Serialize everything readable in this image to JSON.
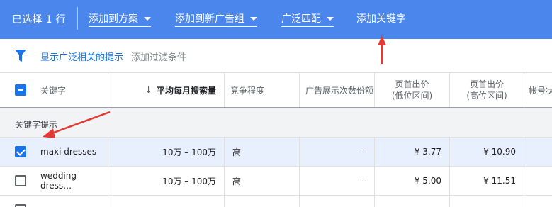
{
  "toolbar": {
    "selection": "已选择 1 行",
    "add_to_plan": "添加到方案",
    "add_to_new_ad_group": "添加到新广告组",
    "match_type": "广泛匹配",
    "add_keyword": "添加关键字"
  },
  "filter": {
    "show_broad": "显示广泛相关的提示",
    "add_filter": "添加过滤条件"
  },
  "table": {
    "headers": {
      "keyword": "关键字",
      "avg_monthly_searches": "平均每月搜索量",
      "sort_arrow": "↓",
      "competition": "竞争程度",
      "ad_impression_share": "广告展示次数份额",
      "top_bid_low": [
        "页首出价",
        "(低位区间)"
      ],
      "top_bid_high": [
        "页首出价",
        "(高位区间)"
      ],
      "account_status": "帐号状"
    },
    "section_label": "关键字提示",
    "rows": [
      {
        "checked": true,
        "keyword": "maxi dresses",
        "searches": "10万 – 100万",
        "competition": "高",
        "impression_share": "–",
        "bid_low": "¥ 3.77",
        "bid_high": "¥ 10.90"
      },
      {
        "checked": false,
        "keyword": "wedding dress…",
        "searches": "10万 – 100万",
        "competition": "高",
        "impression_share": "–",
        "bid_low": "¥ 5.00",
        "bid_high": "¥ 11.51"
      }
    ]
  },
  "colors": {
    "toolbar_bg": "#4a86ec",
    "accent": "#1a73e8",
    "selected_row": "#e8f0fe",
    "annotation_arrow": "#e53935"
  },
  "icons": [
    "filter-icon",
    "chevron-down-icon",
    "sort-down-arrow-icon",
    "checkbox-icon",
    "red-annotation-arrow"
  ]
}
